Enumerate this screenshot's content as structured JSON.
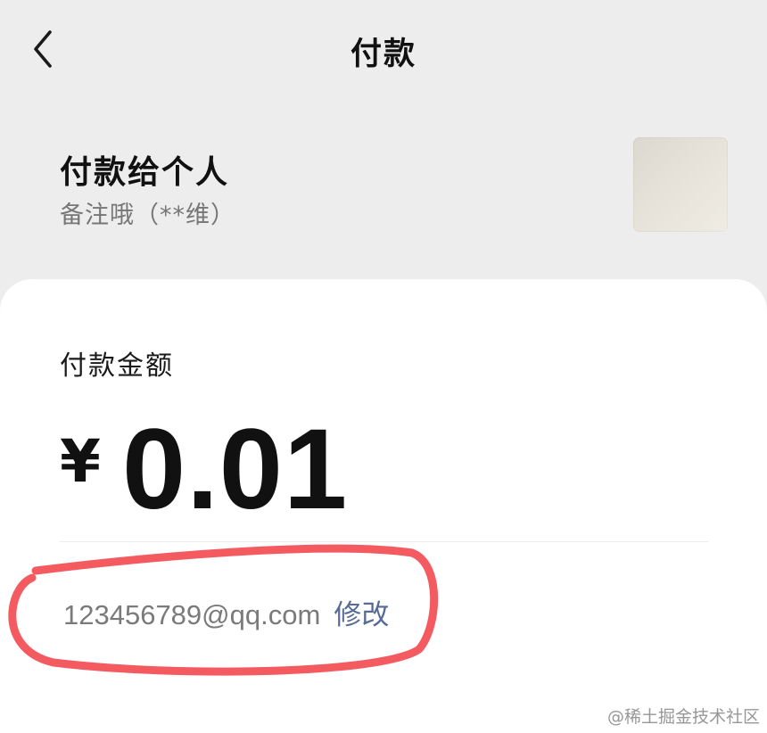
{
  "nav": {
    "title": "付款",
    "back_icon": "chevron-left-icon"
  },
  "payee": {
    "name": "付款给个人",
    "note": "备注哦（**维）"
  },
  "payment": {
    "amount_label": "付款金额",
    "currency_symbol": "¥",
    "amount": "0.01"
  },
  "contact": {
    "email": "123456789@qq.com",
    "edit_label": "修改"
  },
  "annotation": {
    "color": "#f45b61"
  },
  "watermark": "@稀土掘金技术社区",
  "colors": {
    "page_background": "#ededed",
    "card_background": "#ffffff",
    "link": "#576b95",
    "secondary_text": "#767676"
  }
}
